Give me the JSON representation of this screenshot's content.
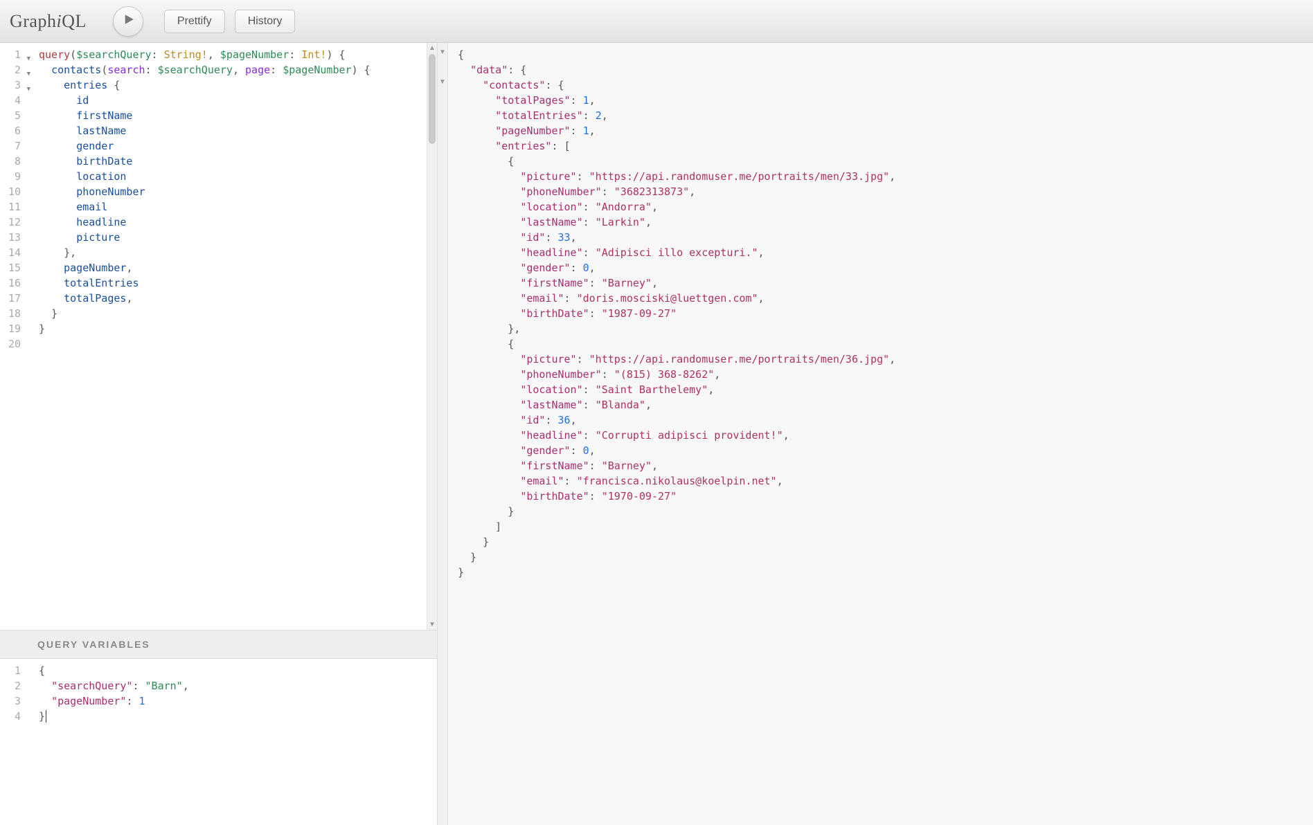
{
  "toolbar": {
    "logo_prefix": "Graph",
    "logo_i": "i",
    "logo_suffix": "QL",
    "prettify_label": "Prettify",
    "history_label": "History"
  },
  "query_editor": {
    "line_count": 20,
    "fold_lines": [
      1,
      2,
      3
    ],
    "tokens": [
      [
        {
          "t": "query",
          "c": "kw"
        },
        {
          "t": "(",
          "c": "punc"
        },
        {
          "t": "$searchQuery",
          "c": "var"
        },
        {
          "t": ": ",
          "c": "punc"
        },
        {
          "t": "String!",
          "c": "type"
        },
        {
          "t": ", ",
          "c": "punc"
        },
        {
          "t": "$pageNumber",
          "c": "var"
        },
        {
          "t": ": ",
          "c": "punc"
        },
        {
          "t": "Int!",
          "c": "type"
        },
        {
          "t": ") {",
          "c": "punc"
        }
      ],
      [
        {
          "t": "  ",
          "c": ""
        },
        {
          "t": "contacts",
          "c": "def"
        },
        {
          "t": "(",
          "c": "punc"
        },
        {
          "t": "search",
          "c": "arg"
        },
        {
          "t": ": ",
          "c": "punc"
        },
        {
          "t": "$searchQuery",
          "c": "var"
        },
        {
          "t": ", ",
          "c": "punc"
        },
        {
          "t": "page",
          "c": "arg"
        },
        {
          "t": ": ",
          "c": "punc"
        },
        {
          "t": "$pageNumber",
          "c": "var"
        },
        {
          "t": ") {",
          "c": "punc"
        }
      ],
      [
        {
          "t": "    ",
          "c": ""
        },
        {
          "t": "entries",
          "c": "def"
        },
        {
          "t": " {",
          "c": "punc"
        }
      ],
      [
        {
          "t": "      ",
          "c": ""
        },
        {
          "t": "id",
          "c": "def"
        }
      ],
      [
        {
          "t": "      ",
          "c": ""
        },
        {
          "t": "firstName",
          "c": "def"
        }
      ],
      [
        {
          "t": "      ",
          "c": ""
        },
        {
          "t": "lastName",
          "c": "def"
        }
      ],
      [
        {
          "t": "      ",
          "c": ""
        },
        {
          "t": "gender",
          "c": "def"
        }
      ],
      [
        {
          "t": "      ",
          "c": ""
        },
        {
          "t": "birthDate",
          "c": "def"
        }
      ],
      [
        {
          "t": "      ",
          "c": ""
        },
        {
          "t": "location",
          "c": "def"
        }
      ],
      [
        {
          "t": "      ",
          "c": ""
        },
        {
          "t": "phoneNumber",
          "c": "def"
        }
      ],
      [
        {
          "t": "      ",
          "c": ""
        },
        {
          "t": "email",
          "c": "def"
        }
      ],
      [
        {
          "t": "      ",
          "c": ""
        },
        {
          "t": "headline",
          "c": "def"
        }
      ],
      [
        {
          "t": "      ",
          "c": ""
        },
        {
          "t": "picture",
          "c": "def"
        }
      ],
      [
        {
          "t": "    },",
          "c": "punc"
        }
      ],
      [
        {
          "t": "    ",
          "c": ""
        },
        {
          "t": "pageNumber",
          "c": "def"
        },
        {
          "t": ",",
          "c": "punc"
        }
      ],
      [
        {
          "t": "    ",
          "c": ""
        },
        {
          "t": "totalEntries",
          "c": "def"
        }
      ],
      [
        {
          "t": "    ",
          "c": ""
        },
        {
          "t": "totalPages",
          "c": "def"
        },
        {
          "t": ",",
          "c": "punc"
        }
      ],
      [
        {
          "t": "  }",
          "c": "punc"
        }
      ],
      [
        {
          "t": "}",
          "c": "punc"
        }
      ],
      []
    ]
  },
  "variables": {
    "header_label": "QUERY VARIABLES",
    "line_count": 4,
    "tokens": [
      [
        {
          "t": "{",
          "c": "punc"
        }
      ],
      [
        {
          "t": "  ",
          "c": ""
        },
        {
          "t": "\"searchQuery\"",
          "c": "key"
        },
        {
          "t": ": ",
          "c": "punc"
        },
        {
          "t": "\"Barn\"",
          "c": "strg"
        },
        {
          "t": ",",
          "c": "punc"
        }
      ],
      [
        {
          "t": "  ",
          "c": ""
        },
        {
          "t": "\"pageNumber\"",
          "c": "key"
        },
        {
          "t": ": ",
          "c": "punc"
        },
        {
          "t": "1",
          "c": "num"
        }
      ],
      [
        {
          "t": "}",
          "c": "punc"
        },
        {
          "t": "",
          "c": "cursor"
        }
      ]
    ]
  },
  "response": {
    "tokens": [
      [
        {
          "t": "{",
          "c": "punc"
        }
      ],
      [
        {
          "t": "  ",
          "c": ""
        },
        {
          "t": "\"data\"",
          "c": "key"
        },
        {
          "t": ": {",
          "c": "punc"
        }
      ],
      [
        {
          "t": "    ",
          "c": ""
        },
        {
          "t": "\"contacts\"",
          "c": "key"
        },
        {
          "t": ": {",
          "c": "punc"
        }
      ],
      [
        {
          "t": "      ",
          "c": ""
        },
        {
          "t": "\"totalPages\"",
          "c": "key"
        },
        {
          "t": ": ",
          "c": "punc"
        },
        {
          "t": "1",
          "c": "num"
        },
        {
          "t": ",",
          "c": "punc"
        }
      ],
      [
        {
          "t": "      ",
          "c": ""
        },
        {
          "t": "\"totalEntries\"",
          "c": "key"
        },
        {
          "t": ": ",
          "c": "punc"
        },
        {
          "t": "2",
          "c": "num"
        },
        {
          "t": ",",
          "c": "punc"
        }
      ],
      [
        {
          "t": "      ",
          "c": ""
        },
        {
          "t": "\"pageNumber\"",
          "c": "key"
        },
        {
          "t": ": ",
          "c": "punc"
        },
        {
          "t": "1",
          "c": "num"
        },
        {
          "t": ",",
          "c": "punc"
        }
      ],
      [
        {
          "t": "      ",
          "c": ""
        },
        {
          "t": "\"entries\"",
          "c": "key"
        },
        {
          "t": ": [",
          "c": "punc"
        }
      ],
      [
        {
          "t": "        {",
          "c": "punc"
        }
      ],
      [
        {
          "t": "          ",
          "c": ""
        },
        {
          "t": "\"picture\"",
          "c": "key"
        },
        {
          "t": ": ",
          "c": "punc"
        },
        {
          "t": "\"https://api.randomuser.me/portraits/men/33.jpg\"",
          "c": "str"
        },
        {
          "t": ",",
          "c": "punc"
        }
      ],
      [
        {
          "t": "          ",
          "c": ""
        },
        {
          "t": "\"phoneNumber\"",
          "c": "key"
        },
        {
          "t": ": ",
          "c": "punc"
        },
        {
          "t": "\"3682313873\"",
          "c": "str"
        },
        {
          "t": ",",
          "c": "punc"
        }
      ],
      [
        {
          "t": "          ",
          "c": ""
        },
        {
          "t": "\"location\"",
          "c": "key"
        },
        {
          "t": ": ",
          "c": "punc"
        },
        {
          "t": "\"Andorra\"",
          "c": "str"
        },
        {
          "t": ",",
          "c": "punc"
        }
      ],
      [
        {
          "t": "          ",
          "c": ""
        },
        {
          "t": "\"lastName\"",
          "c": "key"
        },
        {
          "t": ": ",
          "c": "punc"
        },
        {
          "t": "\"Larkin\"",
          "c": "str"
        },
        {
          "t": ",",
          "c": "punc"
        }
      ],
      [
        {
          "t": "          ",
          "c": ""
        },
        {
          "t": "\"id\"",
          "c": "key"
        },
        {
          "t": ": ",
          "c": "punc"
        },
        {
          "t": "33",
          "c": "num"
        },
        {
          "t": ",",
          "c": "punc"
        }
      ],
      [
        {
          "t": "          ",
          "c": ""
        },
        {
          "t": "\"headline\"",
          "c": "key"
        },
        {
          "t": ": ",
          "c": "punc"
        },
        {
          "t": "\"Adipisci illo excepturi.\"",
          "c": "str"
        },
        {
          "t": ",",
          "c": "punc"
        }
      ],
      [
        {
          "t": "          ",
          "c": ""
        },
        {
          "t": "\"gender\"",
          "c": "key"
        },
        {
          "t": ": ",
          "c": "punc"
        },
        {
          "t": "0",
          "c": "num"
        },
        {
          "t": ",",
          "c": "punc"
        }
      ],
      [
        {
          "t": "          ",
          "c": ""
        },
        {
          "t": "\"firstName\"",
          "c": "key"
        },
        {
          "t": ": ",
          "c": "punc"
        },
        {
          "t": "\"Barney\"",
          "c": "str"
        },
        {
          "t": ",",
          "c": "punc"
        }
      ],
      [
        {
          "t": "          ",
          "c": ""
        },
        {
          "t": "\"email\"",
          "c": "key"
        },
        {
          "t": ": ",
          "c": "punc"
        },
        {
          "t": "\"doris.mosciski@luettgen.com\"",
          "c": "str"
        },
        {
          "t": ",",
          "c": "punc"
        }
      ],
      [
        {
          "t": "          ",
          "c": ""
        },
        {
          "t": "\"birthDate\"",
          "c": "key"
        },
        {
          "t": ": ",
          "c": "punc"
        },
        {
          "t": "\"1987-09-27\"",
          "c": "str"
        }
      ],
      [
        {
          "t": "        },",
          "c": "punc"
        }
      ],
      [
        {
          "t": "        {",
          "c": "punc"
        }
      ],
      [
        {
          "t": "          ",
          "c": ""
        },
        {
          "t": "\"picture\"",
          "c": "key"
        },
        {
          "t": ": ",
          "c": "punc"
        },
        {
          "t": "\"https://api.randomuser.me/portraits/men/36.jpg\"",
          "c": "str"
        },
        {
          "t": ",",
          "c": "punc"
        }
      ],
      [
        {
          "t": "          ",
          "c": ""
        },
        {
          "t": "\"phoneNumber\"",
          "c": "key"
        },
        {
          "t": ": ",
          "c": "punc"
        },
        {
          "t": "\"(815) 368-8262\"",
          "c": "str"
        },
        {
          "t": ",",
          "c": "punc"
        }
      ],
      [
        {
          "t": "          ",
          "c": ""
        },
        {
          "t": "\"location\"",
          "c": "key"
        },
        {
          "t": ": ",
          "c": "punc"
        },
        {
          "t": "\"Saint Barthelemy\"",
          "c": "str"
        },
        {
          "t": ",",
          "c": "punc"
        }
      ],
      [
        {
          "t": "          ",
          "c": ""
        },
        {
          "t": "\"lastName\"",
          "c": "key"
        },
        {
          "t": ": ",
          "c": "punc"
        },
        {
          "t": "\"Blanda\"",
          "c": "str"
        },
        {
          "t": ",",
          "c": "punc"
        }
      ],
      [
        {
          "t": "          ",
          "c": ""
        },
        {
          "t": "\"id\"",
          "c": "key"
        },
        {
          "t": ": ",
          "c": "punc"
        },
        {
          "t": "36",
          "c": "num"
        },
        {
          "t": ",",
          "c": "punc"
        }
      ],
      [
        {
          "t": "          ",
          "c": ""
        },
        {
          "t": "\"headline\"",
          "c": "key"
        },
        {
          "t": ": ",
          "c": "punc"
        },
        {
          "t": "\"Corrupti adipisci provident!\"",
          "c": "str"
        },
        {
          "t": ",",
          "c": "punc"
        }
      ],
      [
        {
          "t": "          ",
          "c": ""
        },
        {
          "t": "\"gender\"",
          "c": "key"
        },
        {
          "t": ": ",
          "c": "punc"
        },
        {
          "t": "0",
          "c": "num"
        },
        {
          "t": ",",
          "c": "punc"
        }
      ],
      [
        {
          "t": "          ",
          "c": ""
        },
        {
          "t": "\"firstName\"",
          "c": "key"
        },
        {
          "t": ": ",
          "c": "punc"
        },
        {
          "t": "\"Barney\"",
          "c": "str"
        },
        {
          "t": ",",
          "c": "punc"
        }
      ],
      [
        {
          "t": "          ",
          "c": ""
        },
        {
          "t": "\"email\"",
          "c": "key"
        },
        {
          "t": ": ",
          "c": "punc"
        },
        {
          "t": "\"francisca.nikolaus@koelpin.net\"",
          "c": "str"
        },
        {
          "t": ",",
          "c": "punc"
        }
      ],
      [
        {
          "t": "          ",
          "c": ""
        },
        {
          "t": "\"birthDate\"",
          "c": "key"
        },
        {
          "t": ": ",
          "c": "punc"
        },
        {
          "t": "\"1970-09-27\"",
          "c": "str"
        }
      ],
      [
        {
          "t": "        }",
          "c": "punc"
        }
      ],
      [
        {
          "t": "      ]",
          "c": "punc"
        }
      ],
      [
        {
          "t": "    }",
          "c": "punc"
        }
      ],
      [
        {
          "t": "  }",
          "c": "punc"
        }
      ],
      [
        {
          "t": "}",
          "c": "punc"
        }
      ]
    ]
  }
}
